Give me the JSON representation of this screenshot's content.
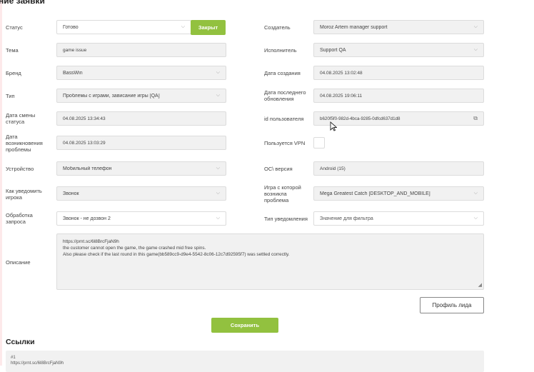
{
  "page": {
    "title": "ние заявки"
  },
  "left": {
    "status_label": "Статус",
    "status_value": "Готово",
    "status_button": "Закрыт",
    "topic_label": "Тема",
    "topic_value": "game issue",
    "brand_label": "Бренд",
    "brand_value": "BassWin",
    "type_label": "Тип",
    "type_value": "Проблемы с играми, зависание игры [QA]",
    "status_change_label": "Дата смены статуса",
    "status_change_value": "04.08.2025 13:34:43",
    "problem_date_label": "Дата возникновения проблемы",
    "problem_date_value": "04.08.2025 13:03:29",
    "device_label": "Устройство",
    "device_value": "Мобильный телефон",
    "notify_label": "Как уведомить игрока",
    "notify_value": "Звонок",
    "processing_label": "Обработка запроса",
    "processing_value": "Звонок - не дозвон 2"
  },
  "right": {
    "creator_label": "Создатель",
    "creator_value": "Moroz Artem manager support",
    "assignee_label": "Исполнитель",
    "assignee_value": "Support QA",
    "created_label": "Дата создания",
    "created_value": "04.08.2025 13:02:48",
    "updated_label": "Дата последнего обновления",
    "updated_value": "04.08.2025 19:06:11",
    "user_id_label": "id пользователя",
    "user_id_value": "b620f5f0-982d-4bca-9285-0dfcd637d1d8",
    "vpn_label": "Пользуется VPN",
    "os_label": "ОС\\ версия",
    "os_value": "Android (15)",
    "game_label": "Игра с которой возникла проблема",
    "game_value": "Mega Greatest Catch [DESKTOP_AND_MOBILE]",
    "notif_type_label": "Тип уведомления",
    "notif_type_placeholder": "Значение для фильтра"
  },
  "description": {
    "label": "Описание",
    "lines": [
      "https://prnt.sc/6l8BrcFjaN9h",
      "the customer cannot open the game, the game crashed mid free spins.",
      "Also please check if the last round in this game(bb589cc9-d9e4-5542-8c06-12c7d92595f7) was settled correctly."
    ]
  },
  "buttons": {
    "lead_profile": "Профиль лида",
    "save": "Сохранить"
  },
  "links": {
    "title": "Ссылки",
    "items": [
      "#1",
      "https://prnt.sc/6l8BrcFjaN9h"
    ]
  },
  "colors": {
    "accent_green": "#92c13f",
    "field_bg": "#f1f1f1"
  }
}
